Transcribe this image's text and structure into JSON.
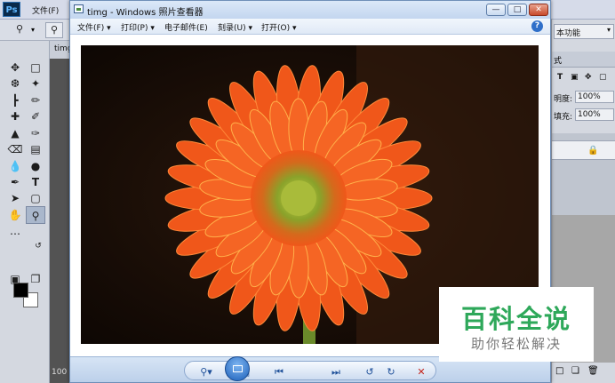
{
  "photoshop": {
    "menu_file": "文件(F)",
    "doc_tab": "timg",
    "zoom": "100",
    "workspace": "本功能",
    "panel_tab": "式",
    "opacity_label": "明度:",
    "opacity_value": "100%",
    "fill_label": "填充:",
    "fill_value": "100%"
  },
  "viewer": {
    "title": "timg - Windows 照片查看器",
    "menus": [
      "文件(F)",
      "打印(P)",
      "电子邮件(E)",
      "刻录(U)",
      "打开(O)"
    ],
    "help": "?"
  },
  "watermark": {
    "title": "百科全说",
    "subtitle": "助你轻松解决"
  },
  "colors": {
    "petal": "#f0571a",
    "petal_light": "#ff8a3a",
    "center": "#8aa22a",
    "photo_bg": "#150b05",
    "watermark_green": "#2ea85a"
  }
}
